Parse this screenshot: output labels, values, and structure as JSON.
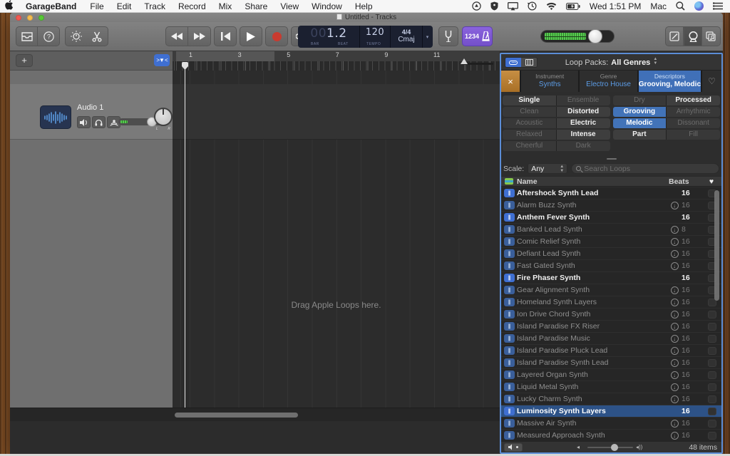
{
  "menubar": {
    "items": [
      "GarageBand",
      "File",
      "Edit",
      "Track",
      "Record",
      "Mix",
      "Share",
      "View",
      "Window",
      "Help"
    ],
    "time": "Wed 1:51 PM",
    "user": "Mac"
  },
  "window": {
    "title": "Untitled - Tracks"
  },
  "toolbar": {
    "lcd": {
      "bar_prefix": "00",
      "bar_beat": "1.2",
      "bar_label": "BAR",
      "beat_label": "BEAT",
      "tempo": "120",
      "tempo_label": "TEMPO",
      "time_sig": "4/4",
      "key": "Cmaj"
    },
    "count_in_label": "1234"
  },
  "tracks": {
    "add_label": "+",
    "track1_name": "Audio 1",
    "pan_left": "L",
    "pan_right": "R"
  },
  "ruler": {
    "marks": [
      "1",
      "3",
      "5",
      "7",
      "9",
      "11"
    ]
  },
  "arrange": {
    "empty_text": "Drag Apple Loops here."
  },
  "loop_browser": {
    "packs_label": "Loop Packs:",
    "packs_value": "All Genres",
    "reset_glyph": "×",
    "filters": [
      {
        "label": "Instrument",
        "value": "Synths",
        "selected": false
      },
      {
        "label": "Genre",
        "value": "Electro House",
        "selected": false
      },
      {
        "label": "Descriptors",
        "value": "Grooving, Melodic",
        "selected": true
      }
    ],
    "descriptors": [
      {
        "label": "Single",
        "state": "on"
      },
      {
        "label": "Ensemble",
        "state": "off"
      },
      {
        "label": "Dry",
        "state": "off"
      },
      {
        "label": "Processed",
        "state": "on"
      },
      {
        "label": "Clean",
        "state": "off"
      },
      {
        "label": "Distorted",
        "state": "on"
      },
      {
        "label": "Grooving",
        "state": "sel"
      },
      {
        "label": "Arrhythmic",
        "state": "off"
      },
      {
        "label": "Acoustic",
        "state": "off"
      },
      {
        "label": "Electric",
        "state": "on"
      },
      {
        "label": "Melodic",
        "state": "sel"
      },
      {
        "label": "Dissonant",
        "state": "off"
      },
      {
        "label": "Relaxed",
        "state": "off"
      },
      {
        "label": "Intense",
        "state": "on"
      },
      {
        "label": "Part",
        "state": "on"
      },
      {
        "label": "Fill",
        "state": "off"
      },
      {
        "label": "Cheerful",
        "state": "off"
      },
      {
        "label": "Dark",
        "state": "off"
      },
      {
        "label": "",
        "state": "empty"
      },
      {
        "label": "",
        "state": "empty"
      }
    ],
    "scale_label": "Scale:",
    "scale_value": "Any",
    "search_placeholder": "Search Loops",
    "table": {
      "name_header": "Name",
      "beats_header": "Beats"
    },
    "loops": [
      {
        "name": "Aftershock Synth Lead",
        "beats": "16",
        "downloaded": true,
        "selected": false
      },
      {
        "name": "Alarm Buzz Synth",
        "beats": "16",
        "downloaded": false,
        "selected": false
      },
      {
        "name": "Anthem Fever Synth",
        "beats": "16",
        "downloaded": true,
        "selected": false
      },
      {
        "name": "Banked Lead Synth",
        "beats": "8",
        "downloaded": false,
        "selected": false
      },
      {
        "name": "Comic Relief Synth",
        "beats": "16",
        "downloaded": false,
        "selected": false
      },
      {
        "name": "Defiant Lead Synth",
        "beats": "16",
        "downloaded": false,
        "selected": false
      },
      {
        "name": "Fast Gated Synth",
        "beats": "16",
        "downloaded": false,
        "selected": false
      },
      {
        "name": "Fire Phaser Synth",
        "beats": "16",
        "downloaded": true,
        "selected": false
      },
      {
        "name": "Gear Alignment Synth",
        "beats": "16",
        "downloaded": false,
        "selected": false
      },
      {
        "name": "Homeland Synth Layers",
        "beats": "16",
        "downloaded": false,
        "selected": false
      },
      {
        "name": "Ion Drive Chord Synth",
        "beats": "16",
        "downloaded": false,
        "selected": false
      },
      {
        "name": "Island Paradise FX Riser",
        "beats": "16",
        "downloaded": false,
        "selected": false
      },
      {
        "name": "Island Paradise Music",
        "beats": "16",
        "downloaded": false,
        "selected": false
      },
      {
        "name": "Island Paradise Pluck Lead",
        "beats": "16",
        "downloaded": false,
        "selected": false
      },
      {
        "name": "Island Paradise Synth Lead",
        "beats": "16",
        "downloaded": false,
        "selected": false
      },
      {
        "name": "Layered Organ Synth",
        "beats": "16",
        "downloaded": false,
        "selected": false
      },
      {
        "name": "Liquid Metal Synth",
        "beats": "16",
        "downloaded": false,
        "selected": false
      },
      {
        "name": "Lucky Charm Synth",
        "beats": "16",
        "downloaded": false,
        "selected": false
      },
      {
        "name": "Luminosity Synth Layers",
        "beats": "16",
        "downloaded": true,
        "selected": true,
        "loading": true
      },
      {
        "name": "Massive Air Synth",
        "beats": "16",
        "downloaded": false,
        "selected": false
      },
      {
        "name": "Measured Approach Synth",
        "beats": "16",
        "downloaded": false,
        "selected": false
      }
    ],
    "items_count": "48 items"
  }
}
